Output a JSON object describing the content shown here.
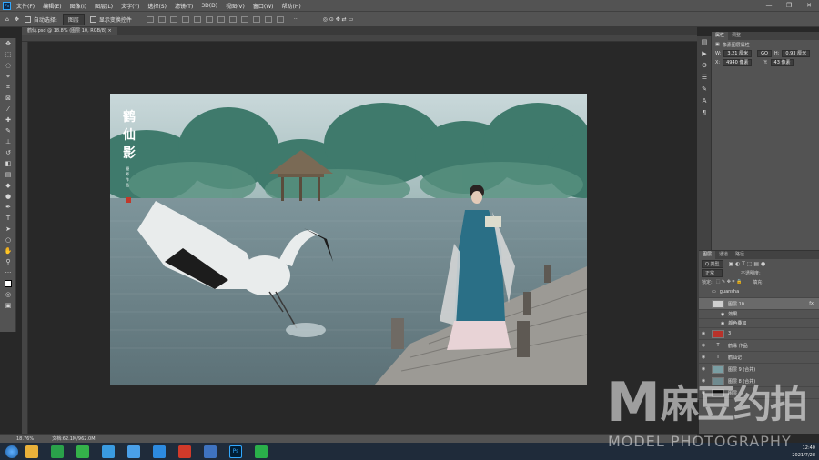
{
  "menu": [
    "文件(F)",
    "编辑(E)",
    "图像(I)",
    "图层(L)",
    "文字(Y)",
    "选择(S)",
    "滤镜(T)",
    "3D(D)",
    "视图(V)",
    "窗口(W)",
    "帮助(H)"
  ],
  "window_controls": [
    "—",
    "❐",
    "✕"
  ],
  "options": {
    "auto_select": "自动选择:",
    "target": "图层",
    "show_transform": "显示变换控件"
  },
  "doc_tab": "鹤仙.psd @ 18.8% (图层 10, RGB/8) ×",
  "canvas_text": {
    "vertical_title": "鹤仙影",
    "credit": "摄 师  作 品"
  },
  "props": {
    "tabs": [
      "属性",
      "调整"
    ],
    "title": "像素图层属性",
    "w_label": "W:",
    "w_value": "3.21 厘米",
    "link": "GO",
    "h_label": "H:",
    "h_value": "0.93 厘米",
    "x_label": "X:",
    "x_value": "4940 像素",
    "y_label": "Y:",
    "y_value": "43 像素"
  },
  "layers": {
    "tabs": [
      "图层",
      "通道",
      "路径"
    ],
    "kind": "Q 类型",
    "blend": "正常",
    "opacity_label": "不透明度:",
    "fill_label": "填充:",
    "lock_label": "锁定:",
    "items": [
      {
        "name": "guansha",
        "kind": "folder"
      },
      {
        "name": "图层 10",
        "kind": "pixel",
        "fx": "fx"
      },
      {
        "name": "效果",
        "kind": "sub"
      },
      {
        "name": "颜色叠加",
        "kind": "sub"
      },
      {
        "name": "3",
        "kind": "pixel"
      },
      {
        "name": "鹤缘 作品",
        "kind": "text"
      },
      {
        "name": "鹤仙记",
        "kind": "text"
      },
      {
        "name": "图层 9 (合并)",
        "kind": "pixel"
      },
      {
        "name": "图层 8 (合并)",
        "kind": "pixel"
      },
      {
        "name": "图层",
        "kind": "pixel"
      }
    ]
  },
  "status": {
    "zoom": "18.76%",
    "doc": "文档:62.1M/962.0M"
  },
  "tray": {
    "time": "12:40",
    "date": "2021/7/28"
  },
  "watermark": {
    "letter": "M",
    "cn": "麻豆约拍",
    "en": "MODEL PHOTOGRAPHY"
  }
}
